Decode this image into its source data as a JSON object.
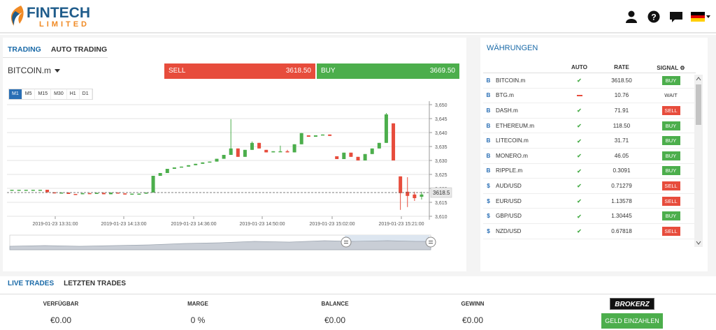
{
  "header": {
    "logo_main": "FINTECH",
    "logo_sub": "LIMITED",
    "colors": {
      "brand_blue": "#1f5c8b",
      "brand_orange": "#f08a24"
    },
    "icons": [
      "user-icon",
      "help-icon",
      "chat-icon",
      "flag-de-icon"
    ]
  },
  "trading": {
    "tabs": [
      "TRADING",
      "AUTO TRADING"
    ],
    "symbol": "BITCOIN.m",
    "sell_label": "SELL",
    "sell_value": "3618.50",
    "buy_label": "BUY",
    "buy_value": "3669.50",
    "timeframes": [
      "M1",
      "M5",
      "M15",
      "M30",
      "H1",
      "D1"
    ]
  },
  "chart_data": {
    "type": "candlestick",
    "y_ticks": [
      "3,650",
      "3,645",
      "3,640",
      "3,635",
      "3,630",
      "3,625",
      "3,620",
      "3,615",
      "3,610"
    ],
    "ylim": [
      3610,
      3650
    ],
    "x_ticks": [
      "2019-01-23 13:31:00",
      "2019-01-23 14:13:00",
      "2019-01-23 14:36:00",
      "2019-01-23 14:50:00",
      "2019-01-23 15:02:00",
      "2019-01-23 15:21:00"
    ],
    "current_price_label": "3618.5",
    "current_price": 3618.5,
    "candles": [
      [
        3619.5,
        3619.5,
        3619.5,
        3619.5
      ],
      [
        3619.5,
        3619.5,
        3619.5,
        3619.5
      ],
      [
        3619.5,
        3619.5,
        3619.5,
        3619.5
      ],
      [
        3619.5,
        3619.5,
        3619.5,
        3619.5
      ],
      [
        3619.5,
        3619.5,
        3619.5,
        3619.5
      ],
      [
        3619.5,
        3619.5,
        3618.6,
        3618.6
      ],
      [
        3618.6,
        3618.6,
        3618.2,
        3618.2
      ],
      [
        3618.2,
        3618.5,
        3618.2,
        3618.5
      ],
      [
        3618.5,
        3618.5,
        3618.0,
        3618.0
      ],
      [
        3618.0,
        3618.0,
        3617.9,
        3617.9
      ],
      [
        3617.9,
        3618.3,
        3617.9,
        3618.3
      ],
      [
        3618.3,
        3618.3,
        3618.0,
        3618.0
      ],
      [
        3618.0,
        3618.4,
        3618.0,
        3618.4
      ],
      [
        3618.4,
        3618.4,
        3617.9,
        3617.9
      ],
      [
        3617.9,
        3618.5,
        3617.9,
        3618.5
      ],
      [
        3618.5,
        3618.5,
        3618.2,
        3618.2
      ],
      [
        3618.2,
        3618.2,
        3617.8,
        3617.8
      ],
      [
        3617.8,
        3618.1,
        3617.8,
        3618.1
      ],
      [
        3618.1,
        3618.2,
        3618.1,
        3618.1
      ],
      [
        3618.1,
        3618.5,
        3618.1,
        3618.5
      ],
      [
        3618.5,
        3624.5,
        3618.5,
        3624.5
      ],
      [
        3624.5,
        3625.5,
        3624.5,
        3625.5
      ],
      [
        3625.5,
        3627.0,
        3625.5,
        3627.0
      ],
      [
        3627.0,
        3627.5,
        3627.0,
        3627.5
      ],
      [
        3627.5,
        3627.8,
        3627.5,
        3627.8
      ],
      [
        3627.8,
        3628.3,
        3627.8,
        3628.3
      ],
      [
        3628.3,
        3628.8,
        3628.3,
        3628.8
      ],
      [
        3628.8,
        3629.3,
        3628.8,
        3629.3
      ],
      [
        3629.3,
        3629.6,
        3629.3,
        3629.6
      ],
      [
        3629.6,
        3630.6,
        3629.6,
        3630.6
      ],
      [
        3630.6,
        3632.0,
        3630.6,
        3632.0
      ],
      [
        3632.0,
        3644.8,
        3632.0,
        3634.3
      ],
      [
        3634.3,
        3634.3,
        3631.3,
        3631.3
      ],
      [
        3631.3,
        3633.8,
        3631.3,
        3633.8
      ],
      [
        3633.8,
        3636.8,
        3633.8,
        3636.3
      ],
      [
        3636.3,
        3636.3,
        3634.3,
        3634.3
      ],
      [
        3633.8,
        3633.8,
        3632.9,
        3632.9
      ],
      [
        3632.9,
        3633.3,
        3632.9,
        3633.3
      ],
      [
        3633.3,
        3635.3,
        3633.3,
        3633.3
      ],
      [
        3633.3,
        3633.8,
        3632.9,
        3632.9
      ],
      [
        3632.9,
        3635.8,
        3632.9,
        3635.8
      ],
      [
        3635.8,
        3639.8,
        3635.8,
        3639.8
      ],
      [
        3639.0,
        3639.0,
        3638.5,
        3638.5
      ],
      [
        3638.5,
        3639.0,
        3638.5,
        3639.0
      ],
      [
        3639.0,
        3639.3,
        3639.0,
        3639.3
      ],
      [
        3639.3,
        3639.3,
        3638.8,
        3638.8
      ],
      [
        3631.5,
        3631.5,
        3630.5,
        3630.5
      ],
      [
        3630.5,
        3632.8,
        3630.5,
        3632.8
      ],
      [
        3632.8,
        3632.8,
        3631.3,
        3631.3
      ],
      [
        3631.3,
        3631.3,
        3630.0,
        3630.0
      ],
      [
        3630.0,
        3632.3,
        3630.0,
        3632.3
      ],
      [
        3632.3,
        3634.3,
        3632.3,
        3634.3
      ],
      [
        3634.3,
        3636.3,
        3634.3,
        3636.3
      ],
      [
        3636.3,
        3647.0,
        3636.3,
        3646.5
      ],
      [
        3643.3,
        3643.3,
        3630.0,
        3630.0
      ],
      [
        3624.3,
        3624.3,
        3612.3,
        3618.3
      ],
      [
        3618.8,
        3624.0,
        3613.3,
        3617.3
      ],
      [
        3617.8,
        3618.8,
        3615.5,
        3616.5
      ],
      [
        3617.0,
        3618.8,
        3616.0,
        3617.8
      ]
    ],
    "navigator": true,
    "grid": true
  },
  "currencies": {
    "title": "WÄHRUNGEN",
    "columns": [
      "",
      "AUTO",
      "RATE",
      "SIGNAL"
    ],
    "rows": [
      {
        "icon": "bitcoin-icon",
        "glyph": "B",
        "name": "BITCOIN.m",
        "auto": "ok",
        "rate": "3618.50",
        "signal": "BUY"
      },
      {
        "icon": "bitcoin-icon",
        "glyph": "B",
        "name": "BTG.m",
        "auto": "dash",
        "rate": "10.76",
        "signal": "WAIT"
      },
      {
        "icon": "bitcoin-icon",
        "glyph": "B",
        "name": "DASH.m",
        "auto": "ok",
        "rate": "71.91",
        "signal": "SELL"
      },
      {
        "icon": "bitcoin-icon",
        "glyph": "B",
        "name": "ETHEREUM.m",
        "auto": "ok",
        "rate": "118.50",
        "signal": "BUY"
      },
      {
        "icon": "bitcoin-icon",
        "glyph": "B",
        "name": "LITECOIN.m",
        "auto": "ok",
        "rate": "31.71",
        "signal": "BUY"
      },
      {
        "icon": "bitcoin-icon",
        "glyph": "B",
        "name": "MONERO.m",
        "auto": "ok",
        "rate": "46.05",
        "signal": "BUY"
      },
      {
        "icon": "bitcoin-icon",
        "glyph": "B",
        "name": "RIPPLE.m",
        "auto": "ok",
        "rate": "0.3091",
        "signal": "BUY"
      },
      {
        "icon": "dollar-icon",
        "glyph": "$",
        "name": "AUD/USD",
        "auto": "ok",
        "rate": "0.71279",
        "signal": "SELL"
      },
      {
        "icon": "dollar-icon",
        "glyph": "$",
        "name": "EUR/USD",
        "auto": "ok",
        "rate": "1.13578",
        "signal": "SELL"
      },
      {
        "icon": "dollar-icon",
        "glyph": "$",
        "name": "GBP/USD",
        "auto": "ok",
        "rate": "1.30445",
        "signal": "BUY"
      },
      {
        "icon": "dollar-icon",
        "glyph": "$",
        "name": "NZD/USD",
        "auto": "ok",
        "rate": "0.67818",
        "signal": "SELL"
      }
    ]
  },
  "bottom": {
    "tabs": [
      "LIVE TRADES",
      "LETZTEN TRADES"
    ],
    "stats": [
      {
        "label": "VERFÜGBAR",
        "value": "€0.00"
      },
      {
        "label": "MARGE",
        "value": "0 %"
      },
      {
        "label": "BALANCE",
        "value": "€0.00"
      },
      {
        "label": "GEWINN",
        "value": "€0.00"
      }
    ],
    "broker_logo": "BROKERZ",
    "deposit_label": "GELD EINZAHLEN"
  }
}
